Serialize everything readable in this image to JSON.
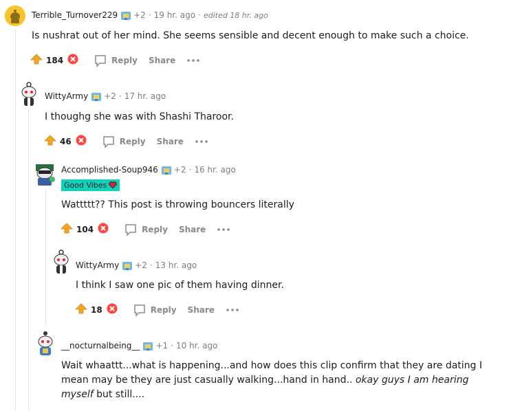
{
  "comments": [
    {
      "username": "Terrible_Turnover229",
      "award_count": "+2",
      "time": "19 hr. ago",
      "edited": "edited 18 hr. ago",
      "body": "Is nushrat out of her mind. She seems sensible and decent enough to make such a choice.",
      "votes": "184",
      "reply": "Reply",
      "share": "Share"
    },
    {
      "username": "WittyArmy",
      "award_count": "+2",
      "time": "17 hr. ago",
      "body": "I thoughg she was with Shashi Tharoor.",
      "votes": "46",
      "reply": "Reply",
      "share": "Share"
    },
    {
      "username": "Accomplished-Soup946",
      "award_count": "+2",
      "time": "16 hr. ago",
      "flair": "Good Vibes",
      "body": "Wattttt?? This post is throwing bouncers literally",
      "votes": "104",
      "reply": "Reply",
      "share": "Share"
    },
    {
      "username": "WittyArmy",
      "award_count": "+2",
      "time": "13 hr. ago",
      "body": "I think I saw one pic of them having dinner.",
      "votes": "18",
      "reply": "Reply",
      "share": "Share"
    },
    {
      "username": "__nocturnalbeing__",
      "award_count": "+1",
      "time": "10 hr. ago",
      "body_plain": "Wait whaattt...what is happening...and how does this clip confirm that they are dating I mean may be they are just casually walking...hand in hand.. ",
      "body_italic": "okay guys I am hearing myself",
      "body_end": " but still...."
    }
  ],
  "colors": {
    "upvote": "#f5a623",
    "downvote": "#ff4444",
    "flair_bg": "#0dd3bb",
    "muted": "#878a8c",
    "thread_line": "#e3e6e8"
  },
  "icons": {
    "upvote": "upvote-arrow-icon",
    "downvote": "downvote-x-icon",
    "reply": "reply-bubble-icon",
    "more": "more-dots-icon",
    "award": "award-icon",
    "heart": "heart-icon"
  }
}
